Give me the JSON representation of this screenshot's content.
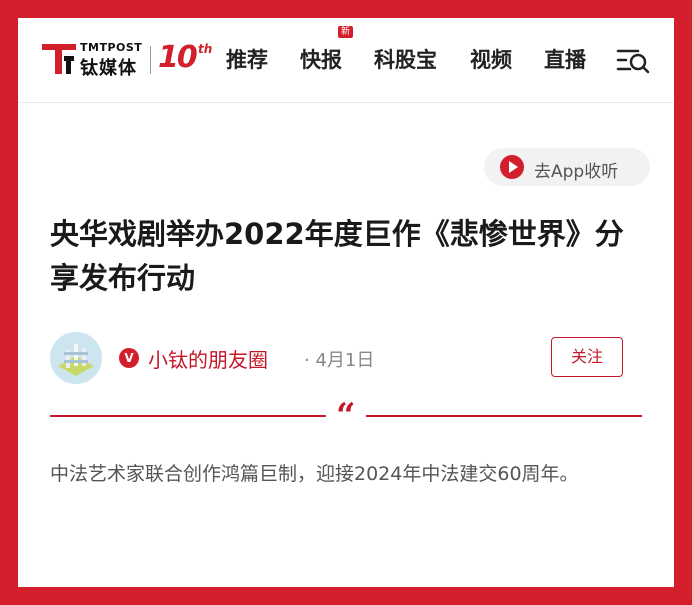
{
  "header": {
    "logo_en": "TMTPOST",
    "logo_cn": "钛媒体",
    "logo_ten": "10",
    "logo_th": "th",
    "nav": [
      {
        "label": "推荐"
      },
      {
        "label": "快报",
        "badge": "新"
      },
      {
        "label": "科股宝"
      },
      {
        "label": "视频"
      },
      {
        "label": "直播"
      }
    ]
  },
  "app_pill": {
    "label": "去App收听"
  },
  "article": {
    "title": "央华戏剧举办2022年度巨作《悲惨世界》分享发布行动",
    "author": "小钛的朋友圈",
    "date": "· 4月1日",
    "verified_mark": "V",
    "follow_label": "关注",
    "quote_mark": "“",
    "summary": "中法艺术家联合创作鸿篇巨制，迎接2024年中法建交60周年。"
  },
  "colors": {
    "brand_red": "#d21f2b",
    "author_red": "#c4182a"
  },
  "icons": {
    "logo_mark": "tmtpost-logo-icon",
    "menu_search": "menu-search-icon",
    "play": "play-icon",
    "verified": "verified-badge-icon"
  }
}
